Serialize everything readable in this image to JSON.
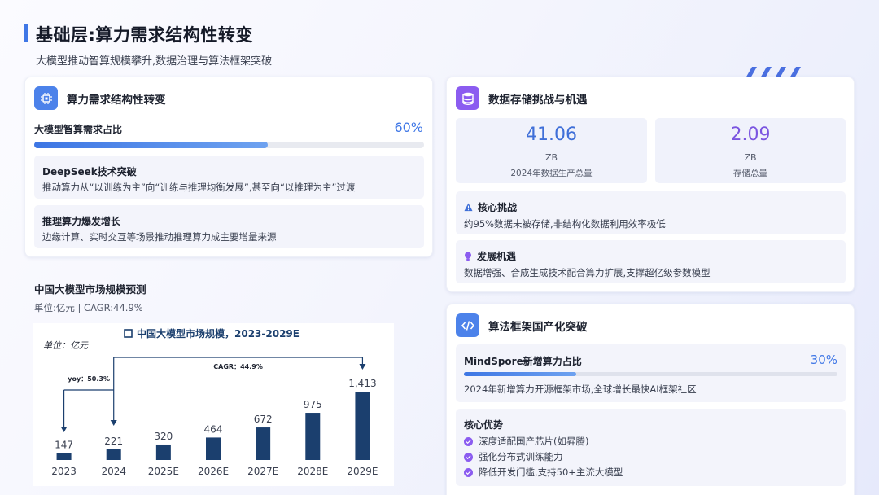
{
  "header": {
    "title": "基础层:算力需求结构性转变",
    "subtitle": "大模型推动智算规模攀升,数据治理与算法框架突破"
  },
  "compute_card": {
    "title": "算力需求结构性转变",
    "icon": "chip-icon",
    "metric_label": "大模型智算需求占比",
    "metric_value": "60%",
    "metric_fraction": 0.6,
    "items": [
      {
        "title": "DeepSeek技术突破",
        "desc": "推动算力从“以训练为主”向“训练与推理均衡发展”,甚至向“以推理为主”过渡"
      },
      {
        "title": "推理算力爆发增长",
        "desc": "边缘计算、实时交互等场景推动推理算力成主要增量来源"
      }
    ]
  },
  "market": {
    "title": "中国大模型市场规模预测",
    "subtitle": "单位:亿元 | CAGR:44.9%"
  },
  "chart_data": {
    "type": "bar",
    "title": "中国大模型市场规模，2023-2029E",
    "unit_label": "单位：亿元",
    "categories": [
      "2023",
      "2024",
      "2025E",
      "2026E",
      "2027E",
      "2028E",
      "2029E"
    ],
    "values": [
      147,
      221,
      320,
      464,
      672,
      975,
      1413
    ],
    "value_labels": [
      "147",
      "221",
      "320",
      "464",
      "672",
      "975",
      "1,413"
    ],
    "annotations": {
      "yoy": "yoy：50.3%",
      "cagr": "CAGR：44.9%"
    },
    "bar_color": "#1b3f6e",
    "ylim": [
      0,
      1413
    ]
  },
  "storage_card": {
    "title": "数据存储挑战与机遇",
    "icon": "database-icon",
    "stats": [
      {
        "value": "41.06",
        "unit": "ZB",
        "caption": "2024年数据生产总量",
        "color": "#3f6fd8"
      },
      {
        "value": "2.09",
        "unit": "ZB",
        "caption": "存储总量",
        "color": "#7b55e0"
      }
    ],
    "challenge": {
      "icon": "warning-icon",
      "title": "核心挑战",
      "desc": "约95%数据未被存储,非结构化数据利用效率极低"
    },
    "opportunity": {
      "icon": "lightbulb-icon",
      "title": "发展机遇",
      "desc": "数据增强、合成生成技术配合算力扩展,支撑超亿级参数模型"
    }
  },
  "algo_card": {
    "title": "算法框架国产化突破",
    "icon": "code-icon",
    "metric_label": "MindSpore新增算力占比",
    "metric_value": "30%",
    "metric_fraction": 0.3,
    "metric_desc": "2024年新增算力开源框架市场,全球增长最快AI框架社区",
    "advantages_title": "核心优势",
    "advantages": [
      "深度适配国产芯片(如昇腾)",
      "强化分布式训练能力",
      "降低开发门槛,支持50+主流大模型"
    ]
  },
  "colors": {
    "accent_blue": "#3f77e6",
    "accent_purple": "#8b5cf0"
  }
}
